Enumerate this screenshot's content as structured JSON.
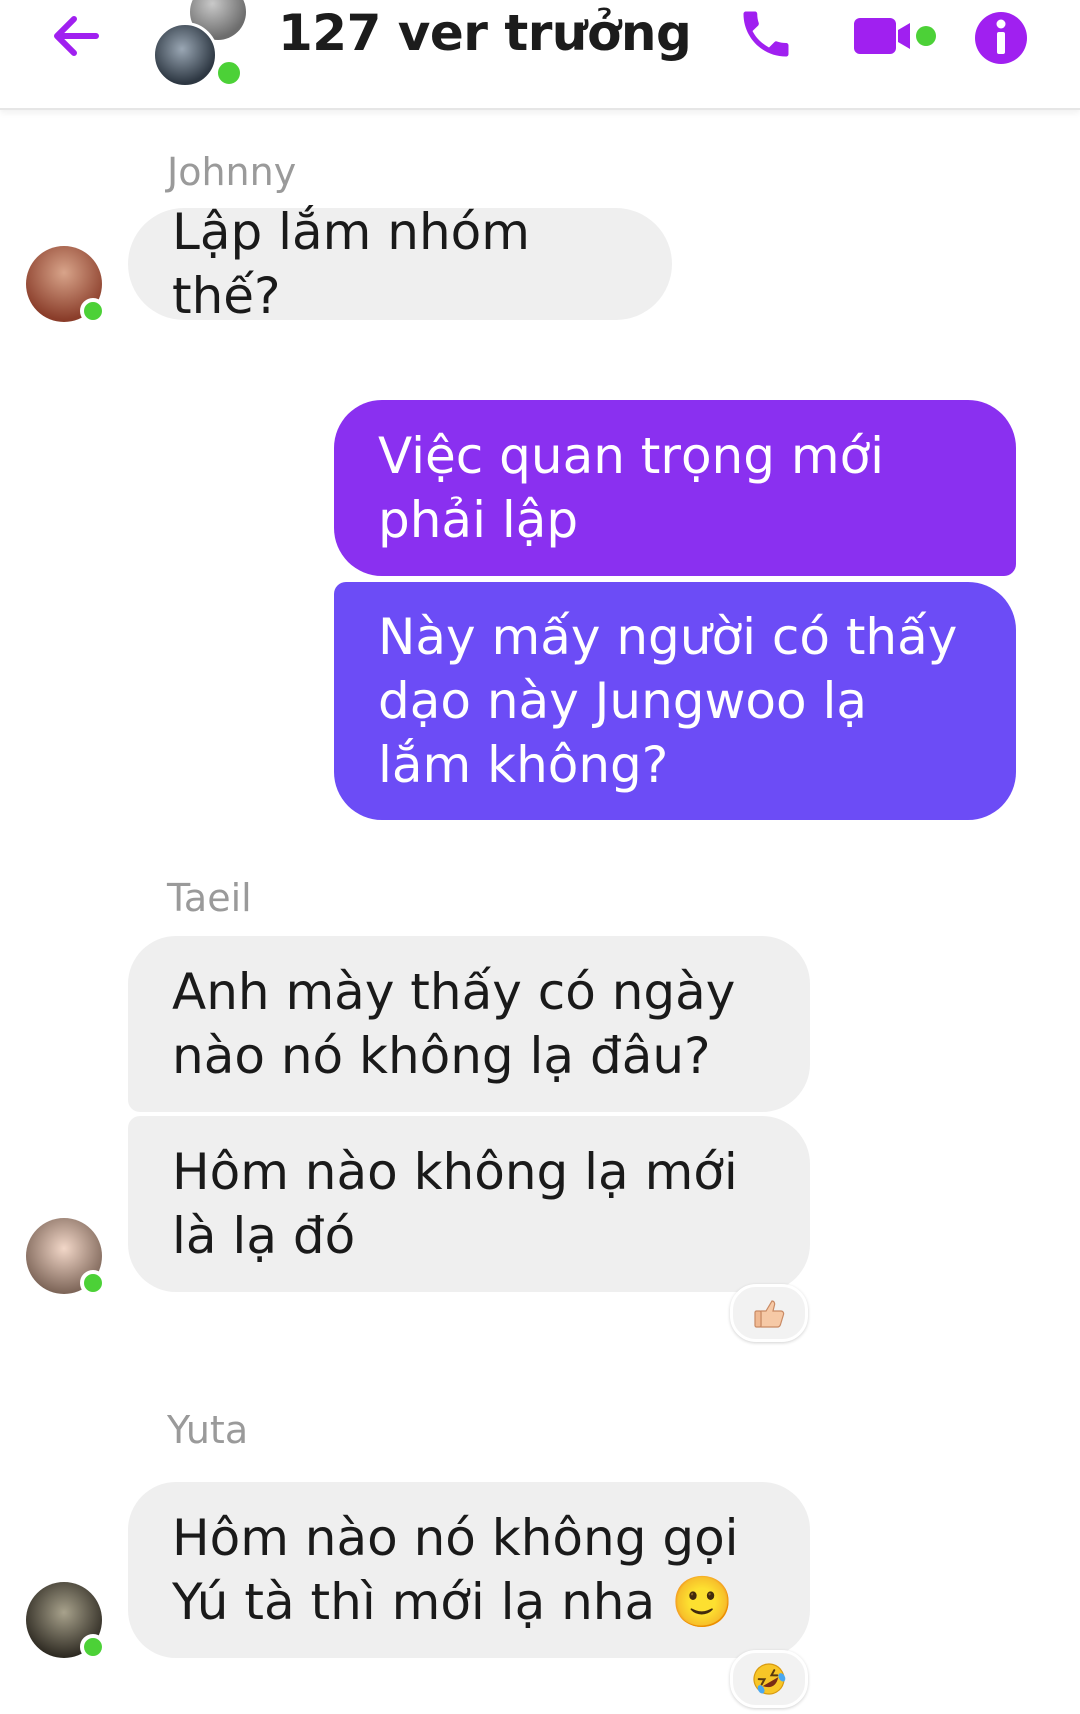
{
  "header": {
    "title": "127 ver trưởng",
    "back_icon": "back-arrow-icon",
    "call_icon": "phone-icon",
    "video_icon": "video-camera-icon",
    "info_icon": "info-icon",
    "accent": "#a020f0",
    "online": "#4cd137"
  },
  "messages": [
    {
      "sender": "Johnny",
      "text": "Lập lắm nhóm thế?"
    },
    {
      "text": "Việc quan trọng mới phải lập"
    },
    {
      "text": "Này mấy người có thấy dạo này Jungwoo lạ lắm không?"
    },
    {
      "sender": "Taeil",
      "text": "Anh mày thấy có ngày nào nó không lạ đâu?"
    },
    {
      "text": "Hôm nào không lạ mới là lạ đó",
      "reaction": "thumbs-up"
    },
    {
      "sender": "Yuta",
      "text": "Hôm nào nó không gọi Yú tà thì mới lạ nha 🙂",
      "reaction": "rolling-on-floor-laughing"
    }
  ],
  "colors": {
    "incoming_bubble": "#efefef",
    "outgoing_top": "#8b2ff0",
    "outgoing_bottom": "#6a4cf6",
    "sender_name": "#9a9a9a"
  }
}
